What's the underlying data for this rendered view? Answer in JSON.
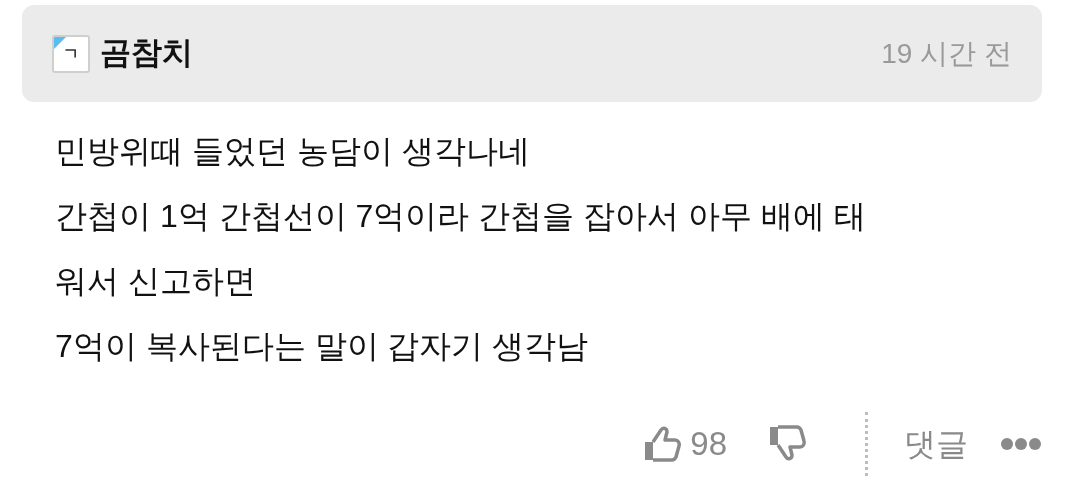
{
  "comment": {
    "avatar_letter": "ㄱ",
    "author": "곰참치",
    "time": "19 시간 전",
    "lines": [
      "민방위때 들었던 농담이 생각나네",
      "간첩이 1억 간첩선이 7억이라 간첩을 잡아서 아무 배에 태",
      "워서 신고하면",
      "7억이 복사된다는 말이 갑자기 생각남"
    ],
    "likes": "98",
    "reply_label": "댓글"
  }
}
